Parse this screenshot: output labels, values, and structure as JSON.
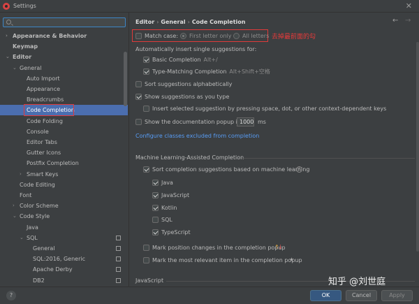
{
  "window": {
    "title": "Settings"
  },
  "search": {
    "value": "",
    "placeholder": ""
  },
  "tree": [
    {
      "label": "Appearance & Behavior",
      "bold": true,
      "arrow": "›"
    },
    {
      "label": "Keymap",
      "bold": true,
      "arrow": ""
    },
    {
      "label": "Editor",
      "bold": true,
      "arrow": "⌄"
    },
    {
      "label": "General",
      "bold": false,
      "arrow": "⌄"
    },
    {
      "label": "Auto Import"
    },
    {
      "label": "Appearance"
    },
    {
      "label": "Breadcrumbs"
    },
    {
      "label": "Code Completion",
      "selected": true
    },
    {
      "label": "Code Folding"
    },
    {
      "label": "Console"
    },
    {
      "label": "Editor Tabs"
    },
    {
      "label": "Gutter Icons"
    },
    {
      "label": "Postfix Completion"
    },
    {
      "label": "Smart Keys",
      "arrow": "›"
    },
    {
      "label": "Code Editing"
    },
    {
      "label": "Font"
    },
    {
      "label": "Color Scheme",
      "arrow": "›"
    },
    {
      "label": "Code Style",
      "arrow": "⌄"
    },
    {
      "label": "Java"
    },
    {
      "label": "SQL",
      "arrow": "⌄"
    },
    {
      "label": "General"
    },
    {
      "label": "SQL:2016, Generic"
    },
    {
      "label": "Apache Derby"
    },
    {
      "label": "DB2"
    }
  ],
  "breadcrumb": {
    "part1": "Editor",
    "sep": "›",
    "part2": "General",
    "part3": "Code Completion"
  },
  "match_case": {
    "label": "Match case:",
    "checked": false,
    "first_letter": "First letter only",
    "all_letters": "All letters"
  },
  "annotation": "去掉最前面的勾",
  "auto_insert": {
    "heading": "Automatically insert single suggestions for:",
    "basic": {
      "label": "Basic Completion",
      "hint": "Alt+/",
      "checked": true
    },
    "type_matching": {
      "label": "Type-Matching Completion",
      "hint": "Alt+Shift+空格",
      "checked": true
    }
  },
  "sort_alpha": {
    "label": "Sort suggestions alphabetically",
    "checked": false
  },
  "show_as_you_type": {
    "label": "Show suggestions as you type",
    "checked": true
  },
  "insert_selected": {
    "label": "Insert selected suggestion by pressing space, dot, or other context-dependent keys",
    "checked": false
  },
  "doc_popup": {
    "label": "Show the documentation popup in",
    "value": "1000",
    "unit": "ms",
    "checked": false
  },
  "configure_link": "Configure classes excluded from completion",
  "ml": {
    "heading": "Machine Learning-Assisted Completion",
    "sort_ml": {
      "label": "Sort completion suggestions based on machine learning",
      "checked": true
    },
    "languages": [
      {
        "label": "Java",
        "checked": true
      },
      {
        "label": "JavaScript",
        "checked": true
      },
      {
        "label": "Kotlin",
        "checked": true
      },
      {
        "label": "SQL",
        "checked": false
      },
      {
        "label": "TypeScript",
        "checked": true
      }
    ],
    "mark_position": {
      "label": "Mark position changes in the completion popup",
      "checked": false,
      "up": "↑",
      "down": "↓"
    },
    "mark_relevant": {
      "label": "Mark the most relevant item in the completion popup",
      "checked": false,
      "star": "★"
    }
  },
  "javascript_heading": "JavaScript",
  "buttons": {
    "help": "?",
    "ok": "OK",
    "cancel": "Cancel",
    "apply": "Apply"
  },
  "watermark": "知乎 @刘世庭"
}
